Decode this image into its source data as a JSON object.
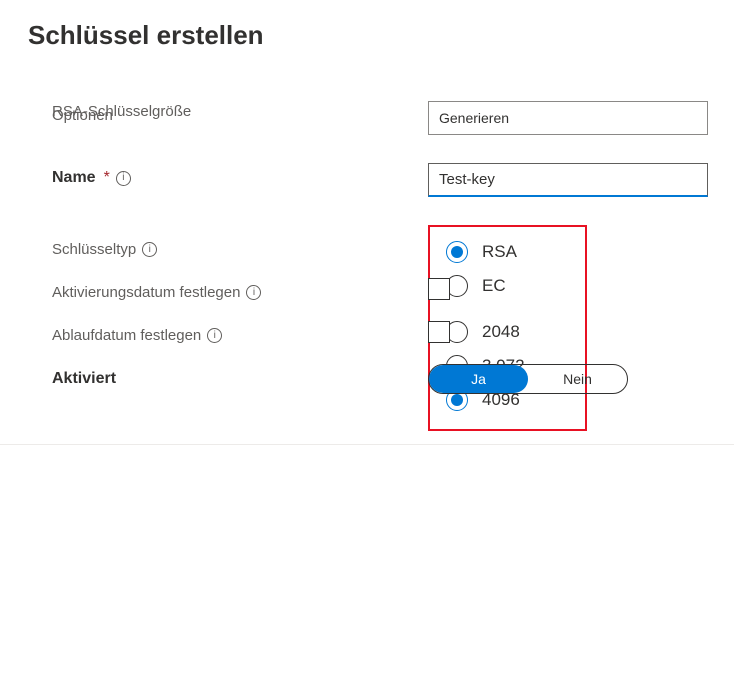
{
  "page": {
    "title": "Schlüssel erstellen"
  },
  "options": {
    "label": "Optionen",
    "value": "Generieren"
  },
  "name": {
    "label": "Name",
    "value": "Test-key"
  },
  "keyType": {
    "label": "Schlüsseltyp",
    "options": {
      "rsa": "RSA",
      "ec": "EC"
    },
    "selected": "rsa"
  },
  "keySize": {
    "label": "RSA-Schlüsselgröße",
    "options": {
      "s2048": "2048",
      "s3072": "3.072",
      "s4096": "4096"
    },
    "selected": "s4096"
  },
  "activationDate": {
    "label": "Aktivierungsdatum festlegen"
  },
  "expiryDate": {
    "label": "Ablaufdatum festlegen"
  },
  "enabled": {
    "label": "Aktiviert",
    "yes": "Ja",
    "no": "Nein"
  }
}
